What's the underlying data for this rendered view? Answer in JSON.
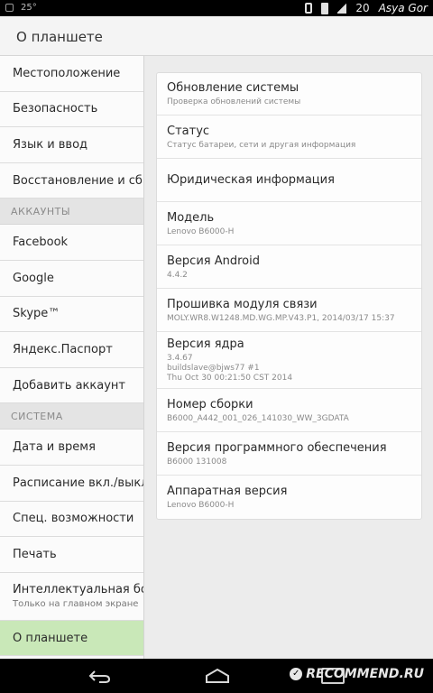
{
  "status_bar": {
    "left_text": "25°",
    "time_partial": "20",
    "watermark_user": "Asya Gor"
  },
  "action_bar": {
    "title": "О планшете"
  },
  "sidebar": {
    "items_top": [
      {
        "label": "Местоположение"
      },
      {
        "label": "Безопасность"
      },
      {
        "label": "Язык и ввод"
      },
      {
        "label": "Восстановление и сброс"
      }
    ],
    "section_accounts": "АККАУНТЫ",
    "accounts": [
      {
        "label": "Facebook"
      },
      {
        "label": "Google"
      },
      {
        "label": "Skype™"
      },
      {
        "label": "Яндекс.Паспорт"
      },
      {
        "label": "Добавить аккаунт"
      }
    ],
    "section_system": "СИСТЕМА",
    "system": [
      {
        "label": "Дата и время"
      },
      {
        "label": "Расписание вкл./выкл."
      },
      {
        "label": "Спец. возможности"
      },
      {
        "label": "Печать"
      },
      {
        "label": "Интеллектуальная боковая панель",
        "sub": "Только на главном экране"
      },
      {
        "label": "О планшете"
      }
    ]
  },
  "about": {
    "items": [
      {
        "title": "Обновление системы",
        "sub": "Проверка обновлений системы"
      },
      {
        "title": "Статус",
        "sub": "Статус батареи, сети и другая информация"
      },
      {
        "title": "Юридическая информация"
      },
      {
        "title": "Модель",
        "sub": "Lenovo B6000-H"
      },
      {
        "title": "Версия Android",
        "sub": "4.4.2"
      },
      {
        "title": "Прошивка модуля связи",
        "sub": "MOLY.WR8.W1248.MD.WG.MP.V43.P1, 2014/03/17 15:37"
      },
      {
        "title": "Версия ядра",
        "sub": "3.4.67",
        "sub2": "buildslave@bjws77 #1",
        "sub3": "Thu Oct 30 00:21:50 CST 2014"
      },
      {
        "title": "Номер сборки",
        "sub": "B6000_A442_001_026_141030_WW_3GDATA"
      },
      {
        "title": "Версия программного обеспечения",
        "sub": "B6000 131008"
      },
      {
        "title": "Аппаратная версия",
        "sub": "Lenovo B6000-H"
      }
    ]
  },
  "watermark": {
    "text": "RECOMMEND.RU",
    "badge": "✓"
  },
  "icons": {
    "back": "back-icon",
    "home": "home-icon",
    "recent": "recent-apps-icon",
    "battery": "battery-icon",
    "vibrate": "vibrate-icon",
    "signal": "signal-icon"
  }
}
